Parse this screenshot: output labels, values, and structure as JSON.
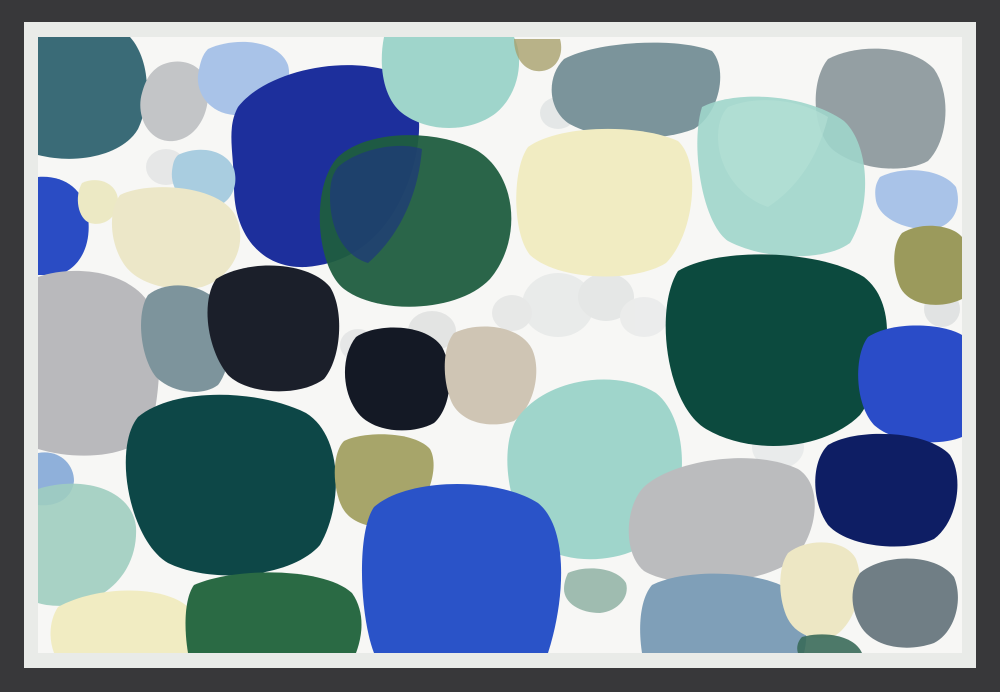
{
  "artwork": {
    "type": "framed abstract painting",
    "palette": {
      "frame": "#38383a",
      "mat": "#e9ebe8",
      "canvas": "#f7f7f5",
      "navy": "#1c2f9a",
      "royal-blue": "#2a53c8",
      "forest-green": "#1f5d3f",
      "deep-teal": "#0c4a48",
      "aqua": "#9fd5cb",
      "cream": "#f1ecc2",
      "grey": "#b7b8bb",
      "slate": "#7d949c",
      "charcoal": "#1b1f2a",
      "olive": "#a7a56a",
      "sky-blue": "#a9c3e8",
      "tan": "#cfc5b4"
    }
  }
}
